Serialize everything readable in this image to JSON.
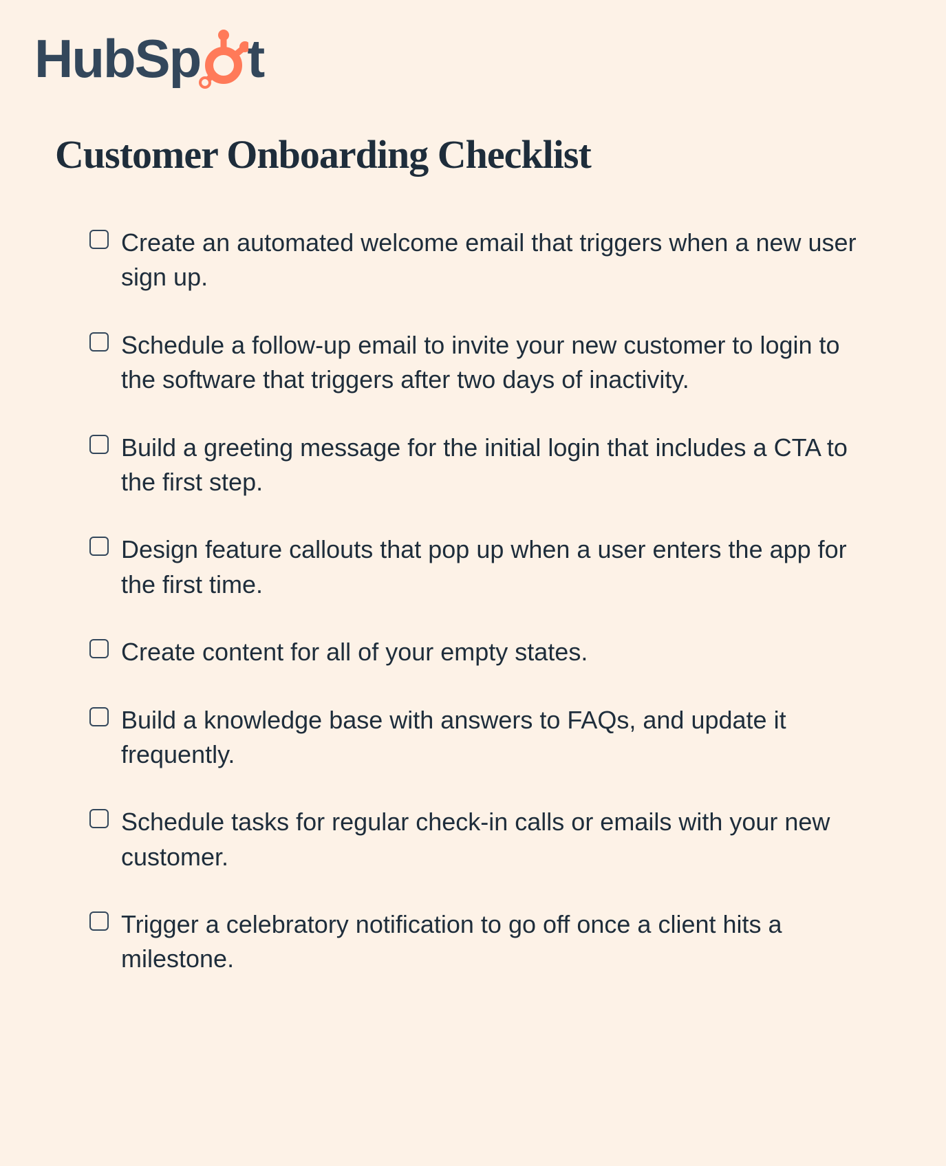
{
  "logo": {
    "text_before": "HubSp",
    "text_after": "t",
    "brand": "HubSpot"
  },
  "title": "Customer Onboarding Checklist",
  "checklist": {
    "items": [
      {
        "text": "Create an automated welcome email that triggers when a new user sign up."
      },
      {
        "text": "Schedule a follow-up email to invite your new customer to login to the software that triggers after two days of inactivity."
      },
      {
        "text": "Build a greeting message for the initial login that includes a CTA to the first step."
      },
      {
        "text": "Design feature callouts that pop up when a user enters the app for the first time."
      },
      {
        "text": "Create content for all of your empty states."
      },
      {
        "text": "Build a knowledge base with answers to FAQs, and update it frequently."
      },
      {
        "text": "Schedule tasks for regular check-in calls or emails with your new customer."
      },
      {
        "text": "Trigger a celebratory notification to go off once a client hits a milestone."
      }
    ]
  },
  "colors": {
    "background": "#fdf2e7",
    "text": "#1e2d3b",
    "logo_dark": "#33475b",
    "logo_orange": "#ff7a59"
  }
}
